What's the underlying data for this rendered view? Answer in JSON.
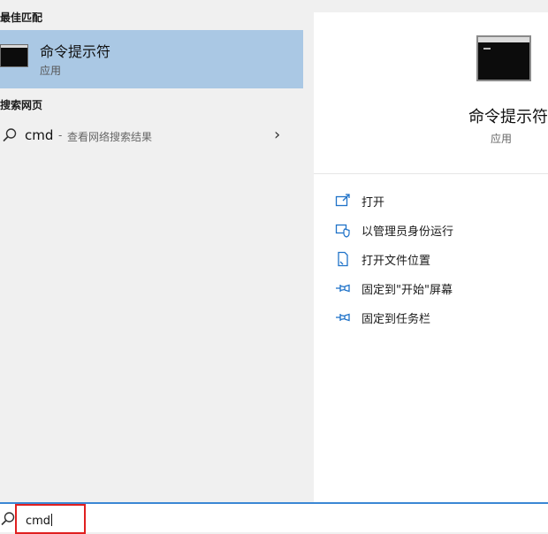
{
  "results": {
    "best_match_heading": "最佳匹配",
    "best_match": {
      "name": "命令提示符",
      "type": "应用"
    },
    "web_heading": "搜索网页",
    "web_item": {
      "query": "cmd",
      "separator": "-",
      "description": "查看网络搜索结果"
    }
  },
  "details": {
    "title": "命令提示符",
    "type": "应用",
    "actions": [
      {
        "label": "打开",
        "icon": "open-window-icon"
      },
      {
        "label": "以管理员身份运行",
        "icon": "admin-shield-icon"
      },
      {
        "label": "打开文件位置",
        "icon": "file-location-icon"
      },
      {
        "label": "固定到\"开始\"屏幕",
        "icon": "pin-icon"
      },
      {
        "label": "固定到任务栏",
        "icon": "pin-icon"
      }
    ]
  },
  "search": {
    "value": "cmd"
  },
  "colors": {
    "selection": "#aac8e4",
    "accent": "#3b87d4",
    "highlight_box": "#e02020",
    "icon_blue": "#1f72c8"
  }
}
